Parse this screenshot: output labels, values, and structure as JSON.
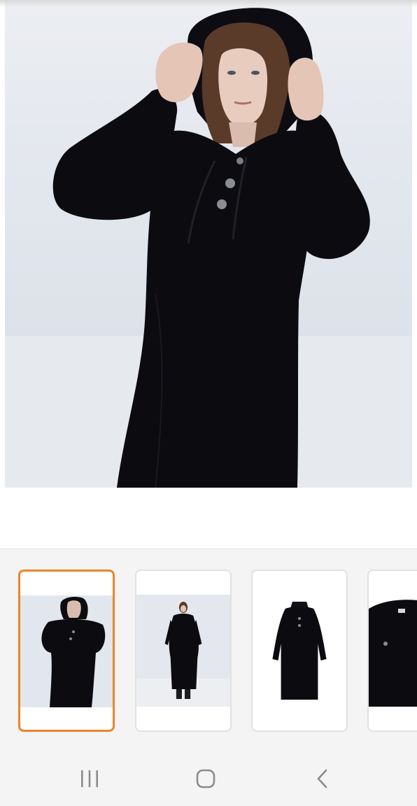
{
  "main_image": {
    "subject": "model-black-hooded-knit-dress",
    "background_color": "#e3e7ee",
    "garment_color": "#0c0b10"
  },
  "thumbnails": [
    {
      "id": "front-hood-up",
      "selected": true
    },
    {
      "id": "full-length",
      "selected": false
    },
    {
      "id": "flat-lay",
      "selected": false
    },
    {
      "id": "detail-closeup",
      "selected": false
    }
  ],
  "selection_color": "#e8862b",
  "nav_bar": {
    "recents_icon": "recents-icon",
    "home_icon": "home-icon",
    "back_icon": "back-icon"
  }
}
